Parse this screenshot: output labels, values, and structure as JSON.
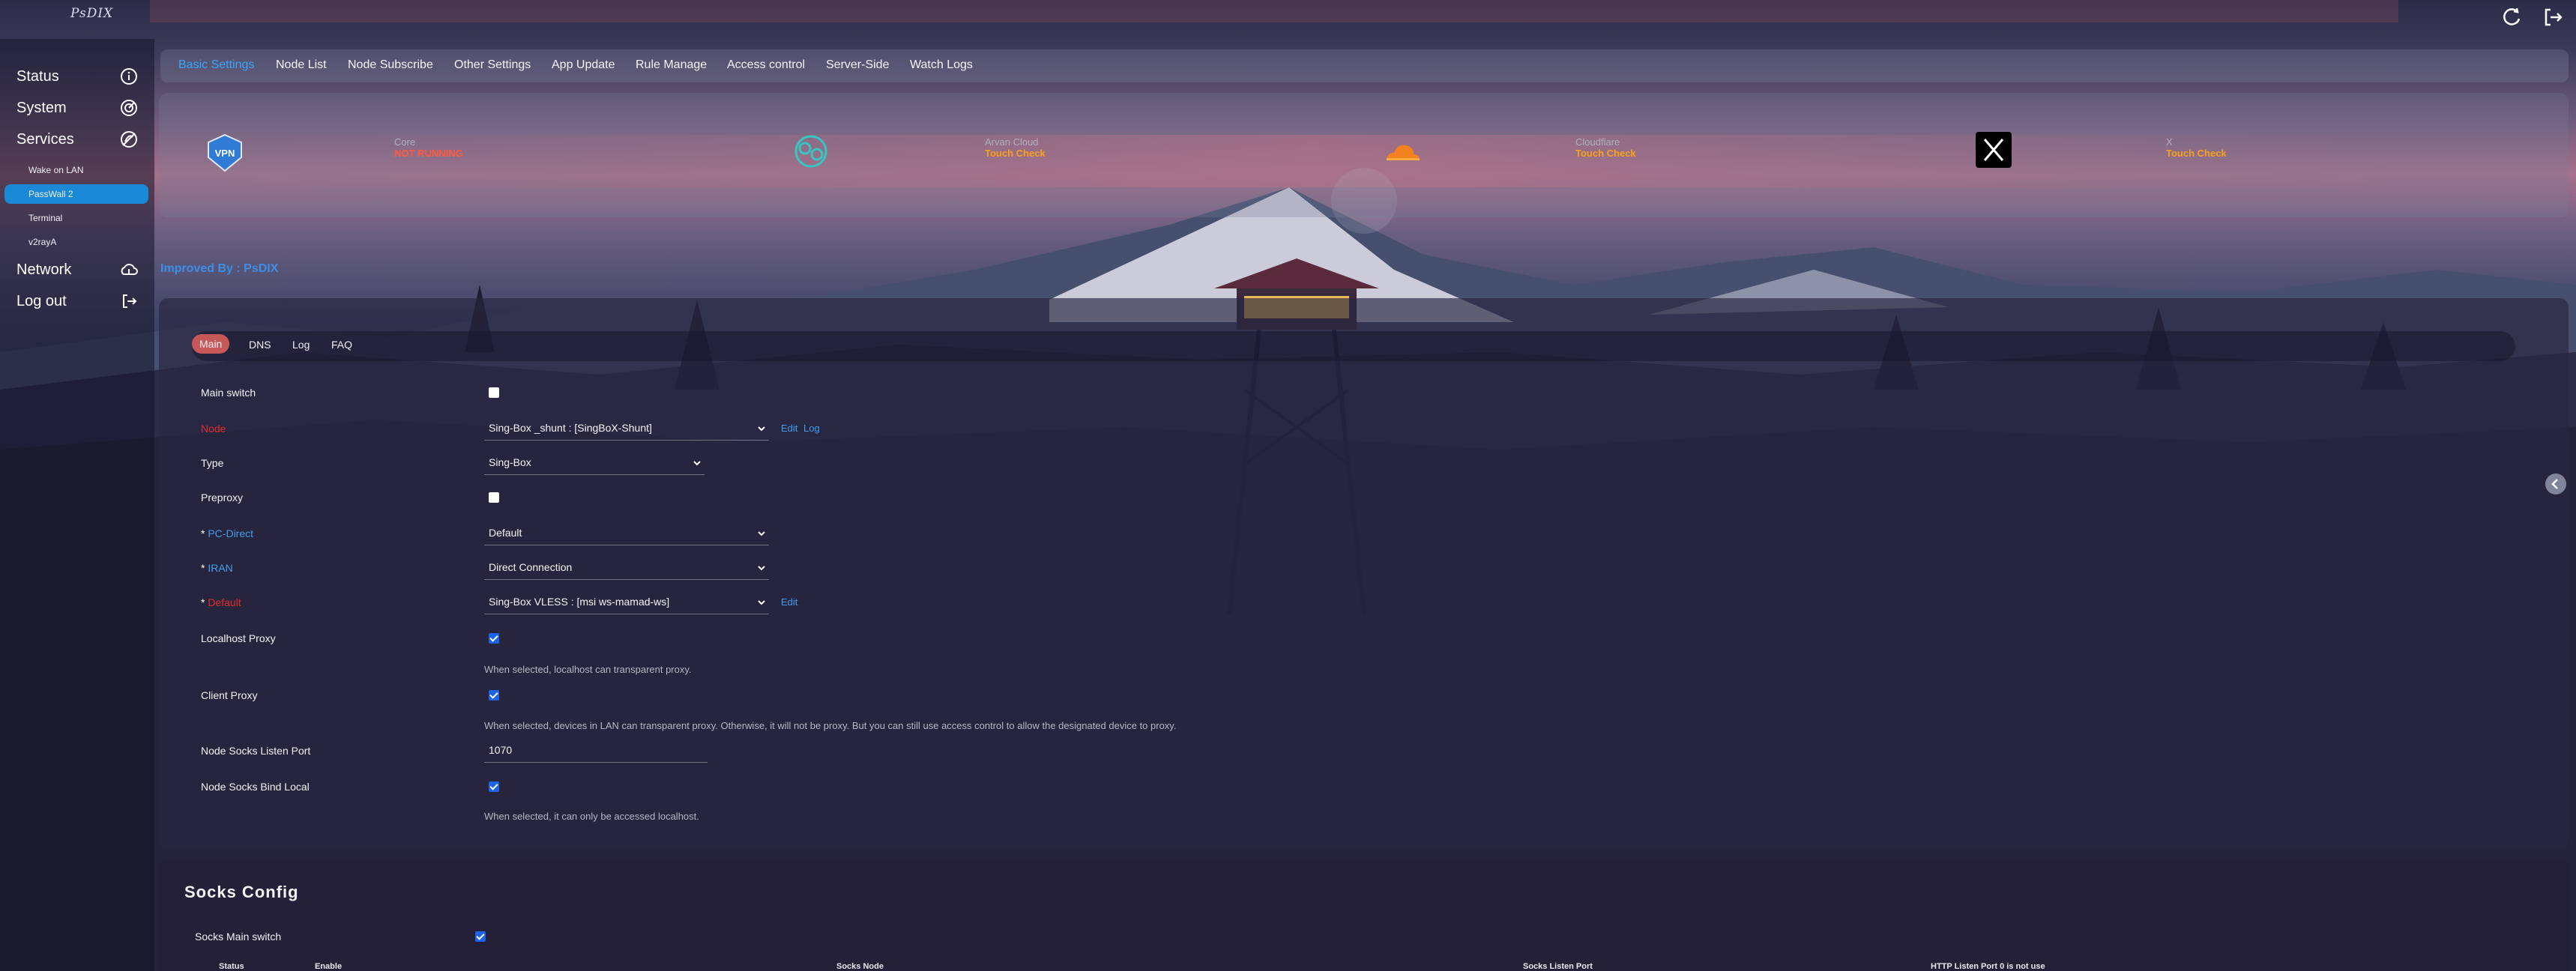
{
  "brand": "PsDIX",
  "sidebar": {
    "items": [
      {
        "label": "Status",
        "icon": "info-icon"
      },
      {
        "label": "System",
        "icon": "system-icon"
      },
      {
        "label": "Services",
        "icon": "services-icon"
      },
      {
        "label": "Network",
        "icon": "network-icon"
      },
      {
        "label": "Log out",
        "icon": "logout-icon"
      }
    ],
    "services_sub": [
      {
        "label": "Wake on LAN"
      },
      {
        "label": "PassWall 2"
      },
      {
        "label": "Terminal"
      },
      {
        "label": "v2rayA"
      }
    ]
  },
  "tabs": [
    "Basic Settings",
    "Node List",
    "Node Subscribe",
    "Other Settings",
    "App Update",
    "Rule Manage",
    "Access control",
    "Server-Side",
    "Watch Logs"
  ],
  "status": [
    {
      "name": "Core",
      "value": "NOT RUNNING",
      "color": "#ff5a3c"
    },
    {
      "name": "Arvan Cloud",
      "value": "Touch Check",
      "color": "#f7a21b"
    },
    {
      "name": "Cloudflare",
      "value": "Touch Check",
      "color": "#f7a21b"
    },
    {
      "name": "X",
      "value": "Touch Check",
      "color": "#f7a21b"
    }
  ],
  "credit": "Improved By : PsDIX",
  "subtabs": [
    "Main",
    "DNS",
    "Log",
    "FAQ"
  ],
  "form": {
    "main_switch": "Main switch",
    "node_label": "Node",
    "node_value": "Sing-Box _shunt : [SingBoX-Shunt]",
    "edit": "Edit",
    "log": "Log",
    "type_label": "Type",
    "type_value": "Sing-Box",
    "preproxy_label": "Preproxy",
    "pc_direct_label": "PC-Direct",
    "pc_direct_value": "Default",
    "iran_label": "IRAN",
    "iran_value": "Direct Connection",
    "default_label": "Default",
    "default_value": "Sing-Box VLESS : [msi ws-mamad-ws]",
    "localhost_label": "Localhost Proxy",
    "localhost_help": "When selected, localhost can transparent proxy.",
    "client_label": "Client Proxy",
    "client_help": "When selected, devices in LAN can transparent proxy. Otherwise, it will not be proxy. But you can still use access control to allow the designated device to proxy.",
    "socks_port_label": "Node Socks Listen Port",
    "socks_port_value": "1070",
    "bind_local_label": "Node Socks Bind Local",
    "bind_local_help": "When selected, it can only be accessed localhost.",
    "star": "*"
  },
  "socks": {
    "title": "Socks Config",
    "main_switch": "Socks Main switch",
    "columns": [
      "Status",
      "Enable",
      "Socks Node",
      "Socks Listen Port",
      "HTTP Listen Port 0 is not use"
    ]
  },
  "colors": {
    "accent": "#1a8ad6",
    "active_subtab": "#c65858",
    "error": "#e12d2d",
    "link": "#3f9ef0"
  }
}
